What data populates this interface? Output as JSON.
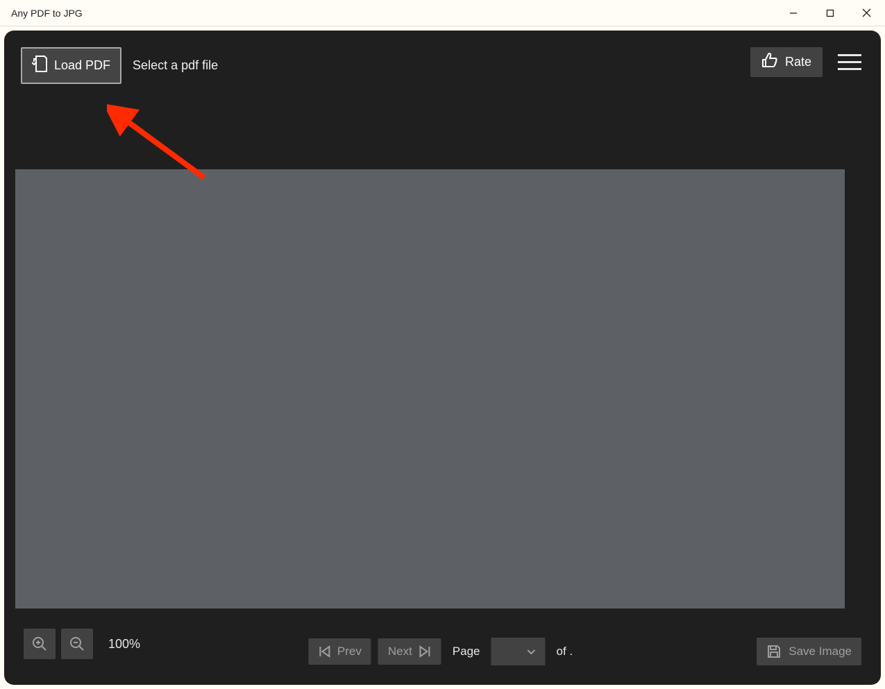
{
  "window": {
    "title": "Any PDF to JPG"
  },
  "toolbar": {
    "load_pdf_label": "Load PDF",
    "hint_text": "Select a pdf file",
    "rate_label": "Rate"
  },
  "bottom": {
    "zoom_level": "100%",
    "prev_label": "Prev",
    "next_label": "Next",
    "page_label": "Page",
    "page_value": "",
    "of_label": "of .",
    "save_label": "Save Image"
  }
}
